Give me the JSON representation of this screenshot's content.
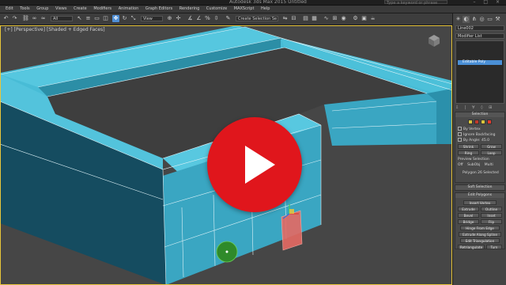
{
  "window": {
    "title": "Autodesk 3ds Max 2015   Untitled",
    "search_placeholder": "Type a keyword or phrase",
    "controls": "– □ ×"
  },
  "menu": [
    "Edit",
    "Tools",
    "Group",
    "Views",
    "Create",
    "Modifiers",
    "Animation",
    "Graph Editors",
    "Rendering",
    "Customize",
    "MAXScript",
    "Help"
  ],
  "toolbar": {
    "undo_icon": "undo-icon",
    "redo_icon": "redo-icon",
    "selection_filter": "All",
    "view_dropdown": "View",
    "named_selection": "Create Selection Se"
  },
  "viewport": {
    "label": "[+] [Perspective] [Shaded + Edged Faces]",
    "active_border_color": "#e8c53a",
    "model_color": "#3aa6c2"
  },
  "command_panel": {
    "object_name": "Line002",
    "modifier_list": "Modifier List",
    "stack_item": "Editable Poly",
    "stack_buttons": "⇩ | ∀ ◊ ⊞",
    "selection": {
      "title": "Selection",
      "by_vertex": "By Vertex",
      "ignore_backfacing": "Ignore Backfacing",
      "by_angle": "By Angle:",
      "by_angle_value": "45.0",
      "shrink": "Shrink",
      "grow": "Grow",
      "ring": "Ring",
      "loop": "Loop",
      "preview_selection": "Preview Selection",
      "preview_off": "Off",
      "preview_subobj": "SubObj",
      "preview_multi": "Multi",
      "status": "Polygon 26 Selected"
    },
    "soft_selection": "Soft Selection",
    "edit_polygons": {
      "title": "Edit Polygons",
      "insert_vertex": "Insert Vertex",
      "extrude": "Extrude",
      "outline": "Outline",
      "bevel": "Bevel",
      "inset": "Inset",
      "bridge": "Bridge",
      "flip": "Flip",
      "hinge_from_edge": "Hinge From Edge",
      "extrude_along_spline": "Extrude Along Spline",
      "edit_triangulation": "Edit Triangulation",
      "retriangulate": "Retriangulate",
      "turn": "Turn"
    },
    "level_colors": [
      "#d8c43c",
      "#c0392b",
      "#d8c43c",
      "#e23b2e"
    ]
  },
  "overlay": {
    "play_button_color": "#e0161c"
  }
}
